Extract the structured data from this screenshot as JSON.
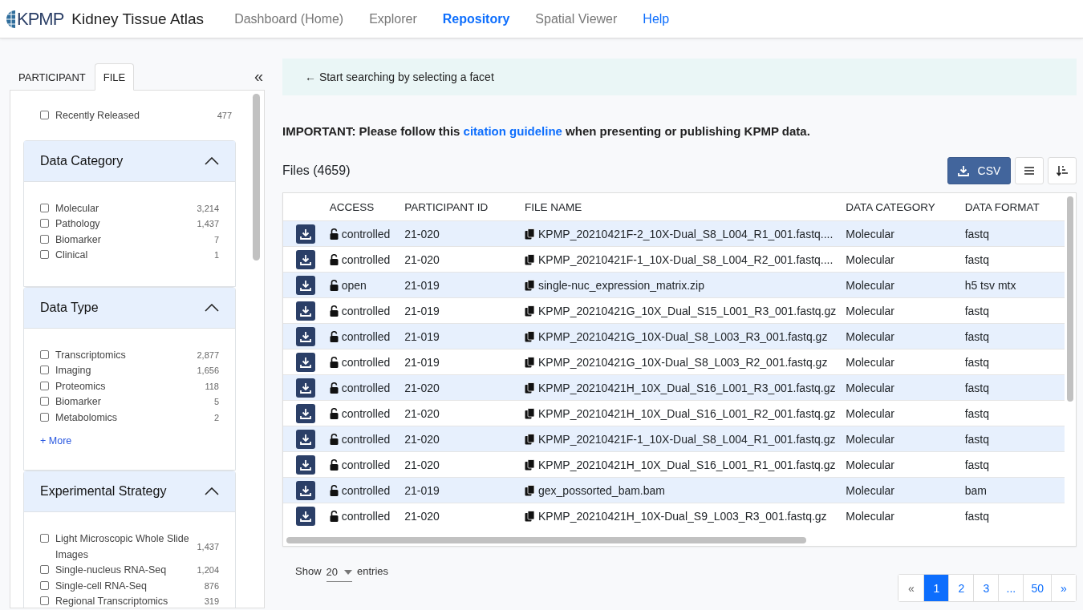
{
  "header": {
    "logo": "KPMP",
    "title": "Kidney Tissue Atlas",
    "nav": [
      {
        "label": "Dashboard (Home)",
        "selected": false,
        "kind": "page"
      },
      {
        "label": "Explorer",
        "selected": false,
        "kind": "page"
      },
      {
        "label": "Repository",
        "selected": true,
        "kind": "page"
      },
      {
        "label": "Spatial Viewer",
        "selected": false,
        "kind": "page"
      },
      {
        "label": "Help",
        "selected": false,
        "kind": "link"
      }
    ]
  },
  "sidebar": {
    "tabs": [
      {
        "label": "PARTICIPANT",
        "selected": false
      },
      {
        "label": "FILE",
        "selected": true
      }
    ],
    "collapse": "«",
    "recently_released": {
      "label": "Recently Released",
      "count": "477",
      "checked": false
    },
    "facets": [
      {
        "title": "Data Category",
        "expanded": true,
        "items": [
          {
            "label": "Molecular",
            "count": "3,214",
            "checked": false
          },
          {
            "label": "Pathology",
            "count": "1,437",
            "checked": false
          },
          {
            "label": "Biomarker",
            "count": "7",
            "checked": false
          },
          {
            "label": "Clinical",
            "count": "1",
            "checked": false
          }
        ]
      },
      {
        "title": "Data Type",
        "expanded": true,
        "more": "+ More",
        "items": [
          {
            "label": "Transcriptomics",
            "count": "2,877",
            "checked": false
          },
          {
            "label": "Imaging",
            "count": "1,656",
            "checked": false
          },
          {
            "label": "Proteomics",
            "count": "118",
            "checked": false
          },
          {
            "label": "Biomarker",
            "count": "5",
            "checked": false
          },
          {
            "label": "Metabolomics",
            "count": "2",
            "checked": false
          }
        ]
      },
      {
        "title": "Experimental Strategy",
        "expanded": true,
        "items": [
          {
            "label": "Light Microscopic Whole Slide Images",
            "count": "1,437",
            "checked": false
          },
          {
            "label": "Single-nucleus RNA-Seq",
            "count": "1,204",
            "checked": false
          },
          {
            "label": "Single-cell RNA-Seq",
            "count": "876",
            "checked": false
          },
          {
            "label": "Regional Transcriptomics",
            "count": "319",
            "checked": false
          }
        ]
      }
    ]
  },
  "hint": "← Start searching by selecting a facet",
  "notice_parts": {
    "before": "IMPORTANT: Please follow this ",
    "link": "citation guideline",
    "after": " when presenting or publishing KPMP data."
  },
  "files": {
    "title": "Files (4659)",
    "csv_button": "CSV"
  },
  "table": {
    "columns": [
      "ACCESS",
      "PARTICIPANT ID",
      "FILE NAME",
      "DATA CATEGORY",
      "DATA FORMAT"
    ],
    "rows": [
      {
        "access": "controlled",
        "participant": "21-020",
        "file": "KPMP_20210421F-2_10X-Dual_S8_L004_R1_001.fastq....",
        "category": "Molecular",
        "format": "fastq"
      },
      {
        "access": "controlled",
        "participant": "21-020",
        "file": "KPMP_20210421F-1_10X-Dual_S8_L004_R2_001.fastq....",
        "category": "Molecular",
        "format": "fastq"
      },
      {
        "access": "open",
        "participant": "21-019",
        "file": "single-nuc_expression_matrix.zip",
        "category": "Molecular",
        "format": "h5 tsv mtx"
      },
      {
        "access": "controlled",
        "participant": "21-019",
        "file": "KPMP_20210421G_10X_Dual_S15_L001_R3_001.fastq.gz",
        "category": "Molecular",
        "format": "fastq"
      },
      {
        "access": "controlled",
        "participant": "21-019",
        "file": "KPMP_20210421G_10X-Dual_S8_L003_R3_001.fastq.gz",
        "category": "Molecular",
        "format": "fastq"
      },
      {
        "access": "controlled",
        "participant": "21-019",
        "file": "KPMP_20210421G_10X-Dual_S8_L003_R2_001.fastq.gz",
        "category": "Molecular",
        "format": "fastq"
      },
      {
        "access": "controlled",
        "participant": "21-020",
        "file": "KPMP_20210421H_10X_Dual_S16_L001_R3_001.fastq.gz",
        "category": "Molecular",
        "format": "fastq"
      },
      {
        "access": "controlled",
        "participant": "21-020",
        "file": "KPMP_20210421H_10X_Dual_S16_L001_R2_001.fastq.gz",
        "category": "Molecular",
        "format": "fastq"
      },
      {
        "access": "controlled",
        "participant": "21-020",
        "file": "KPMP_20210421F-1_10X-Dual_S8_L004_R1_001.fastq.gz",
        "category": "Molecular",
        "format": "fastq"
      },
      {
        "access": "controlled",
        "participant": "21-020",
        "file": "KPMP_20210421H_10X_Dual_S16_L001_R1_001.fastq.gz",
        "category": "Molecular",
        "format": "fastq"
      },
      {
        "access": "controlled",
        "participant": "21-019",
        "file": "gex_possorted_bam.bam",
        "category": "Molecular",
        "format": "bam"
      },
      {
        "access": "controlled",
        "participant": "21-020",
        "file": "KPMP_20210421H_10X-Dual_S9_L003_R3_001.fastq.gz",
        "category": "Molecular",
        "format": "fastq"
      }
    ]
  },
  "page_size": {
    "before": "Show",
    "value": "20",
    "after": "entries"
  },
  "pagination": [
    {
      "label": "«",
      "selected": false
    },
    {
      "label": "1",
      "selected": true
    },
    {
      "label": "2",
      "selected": false
    },
    {
      "label": "3",
      "selected": false
    },
    {
      "label": "...",
      "selected": false
    },
    {
      "label": "50",
      "selected": false
    },
    {
      "label": "»",
      "selected": false
    }
  ]
}
